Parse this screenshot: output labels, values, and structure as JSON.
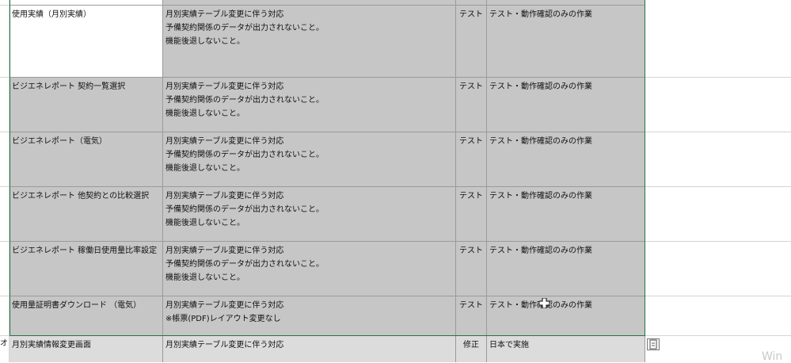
{
  "rows": [
    {
      "screen": "使用実績（月別実績）",
      "desc": "月別実績テーブル変更に伴う対応\n予備契約関係のデータが出力されないこと。\n機能後退しないこと。",
      "type": "テスト",
      "note": "テスト・動作確認のみの作業"
    },
    {
      "screen": "ビジエネレポート 契約一覧選択",
      "desc": "月別実績テーブル変更に伴う対応\n予備契約関係のデータが出力されないこと。\n機能後退しないこと。",
      "type": "テスト",
      "note": "テスト・動作確認のみの作業"
    },
    {
      "screen": "ビジエネレポート（電気）",
      "desc": "月別実績テーブル変更に伴う対応\n予備契約関係のデータが出力されないこと。\n機能後退しないこと。",
      "type": "テスト",
      "note": "テスト・動作確認のみの作業"
    },
    {
      "screen": "ビジエネレポート 他契約との比較選択",
      "desc": "月別実績テーブル変更に伴う対応\n予備契約関係のデータが出力されないこと。\n機能後退しないこと。",
      "type": "テスト",
      "note": "テスト・動作確認のみの作業"
    },
    {
      "screen": "ビジエネレポート 稼働日使用量比率設定",
      "desc": "月別実績テーブル変更に伴う対応\n予備契約関係のデータが出力されないこと。\n機能後退しないこと。",
      "type": "テスト",
      "note": "テスト・動作確認のみの作業"
    },
    {
      "screen": "使用量証明書ダウンロード （電気）",
      "desc": "月別実績テーブル変更に伴う対応\n※帳票(PDF)レイアウト変更なし",
      "type": "テスト",
      "note": "テスト・動作確認のみの作業"
    },
    {
      "screen": "月別実績情報変更画面",
      "desc": "月別実績テーブル変更に伴う対応",
      "type": "修正",
      "note": "日本で実施"
    }
  ],
  "left_fragment": "オ",
  "watermark_text": "Win",
  "colors": {
    "cell_grey": "#c6c6c6",
    "cell_light": "#dcdcdc",
    "selection_border": "#227447"
  }
}
